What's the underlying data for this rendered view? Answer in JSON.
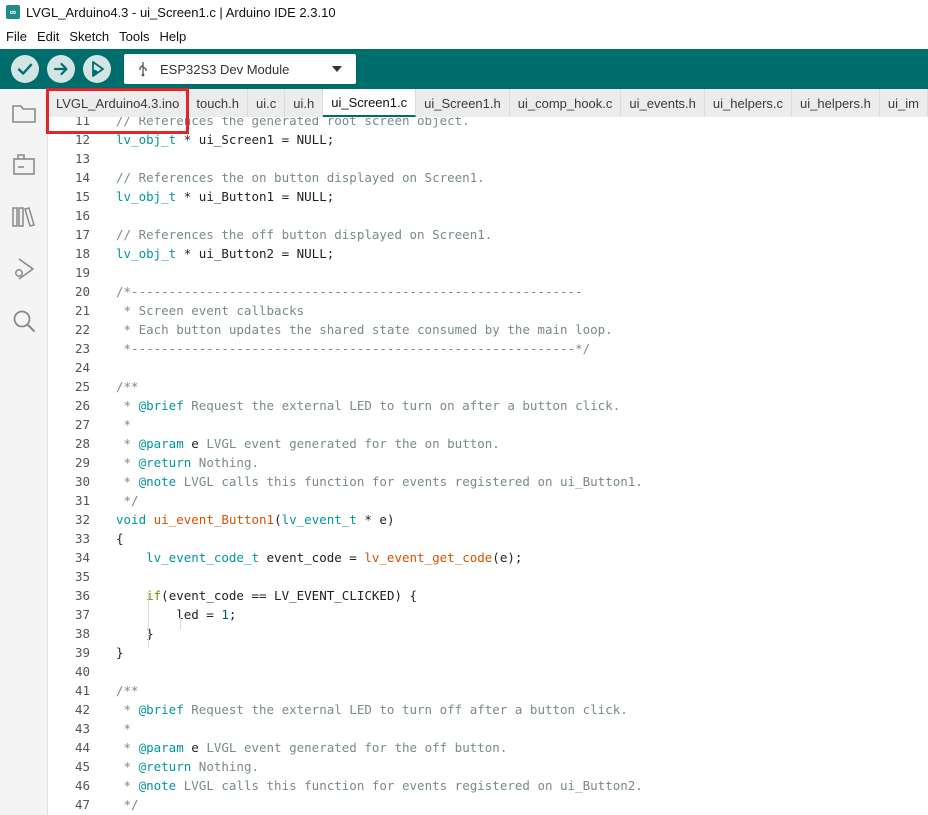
{
  "window": {
    "title": "LVGL_Arduino4.3 - ui_Screen1.c | Arduino IDE 2.3.10",
    "app_icon_glyph": "∞"
  },
  "menu": [
    "File",
    "Edit",
    "Sketch",
    "Tools",
    "Help"
  ],
  "toolbar": {
    "verify_icon": "check-icon",
    "upload_icon": "arrow-right-icon",
    "debug_icon": "debug-icon",
    "board": "ESP32S3 Dev Module"
  },
  "sidebar": [
    "folder-icon",
    "board-manager-icon",
    "library-icon",
    "debug-icon",
    "search-icon"
  ],
  "tabs": [
    {
      "label": "LVGL_Arduino4.3.ino",
      "active": false
    },
    {
      "label": "touch.h",
      "active": false
    },
    {
      "label": "ui.c",
      "active": false
    },
    {
      "label": "ui.h",
      "active": false
    },
    {
      "label": "ui_Screen1.c",
      "active": true
    },
    {
      "label": "ui_Screen1.h",
      "active": false
    },
    {
      "label": "ui_comp_hook.c",
      "active": false
    },
    {
      "label": "ui_events.h",
      "active": false
    },
    {
      "label": "ui_helpers.c",
      "active": false
    },
    {
      "label": "ui_helpers.h",
      "active": false
    },
    {
      "label": "ui_im",
      "active": false
    }
  ],
  "colors": {
    "accent": "#006d6d",
    "highlight": "#e0262b",
    "comment": "#7a8a8b",
    "type": "#00979d",
    "function": "#d35400",
    "keyword": "#728e00"
  },
  "code": [
    {
      "n": "11",
      "tokens": [
        [
          "c",
          "// References the generated root screen object."
        ]
      ]
    },
    {
      "n": "12",
      "tokens": [
        [
          "t",
          "lv_obj_t"
        ],
        [
          "p",
          " * ui_Screen1 = NULL;"
        ]
      ]
    },
    {
      "n": "13",
      "tokens": []
    },
    {
      "n": "14",
      "tokens": [
        [
          "c",
          "// References the on button displayed on Screen1."
        ]
      ]
    },
    {
      "n": "15",
      "tokens": [
        [
          "t",
          "lv_obj_t"
        ],
        [
          "p",
          " * ui_Button1 = NULL;"
        ]
      ]
    },
    {
      "n": "16",
      "tokens": []
    },
    {
      "n": "17",
      "tokens": [
        [
          "c",
          "// References the off button displayed on Screen1."
        ]
      ]
    },
    {
      "n": "18",
      "tokens": [
        [
          "t",
          "lv_obj_t"
        ],
        [
          "p",
          " * ui_Button2 = NULL;"
        ]
      ]
    },
    {
      "n": "19",
      "tokens": []
    },
    {
      "n": "20",
      "tokens": [
        [
          "c",
          "/*------------------------------------------------------------"
        ]
      ]
    },
    {
      "n": "21",
      "tokens": [
        [
          "c",
          " * Screen event callbacks"
        ]
      ]
    },
    {
      "n": "22",
      "tokens": [
        [
          "c",
          " * Each button updates the shared state consumed by the main loop."
        ]
      ]
    },
    {
      "n": "23",
      "tokens": [
        [
          "c",
          " *-----------------------------------------------------------*/"
        ]
      ]
    },
    {
      "n": "24",
      "tokens": []
    },
    {
      "n": "25",
      "tokens": [
        [
          "c",
          "/**"
        ]
      ]
    },
    {
      "n": "26",
      "tokens": [
        [
          "c",
          " * "
        ],
        [
          "t",
          "@brief"
        ],
        [
          "c",
          " Request the external LED to turn on after a button click."
        ]
      ]
    },
    {
      "n": "27",
      "tokens": [
        [
          "c",
          " *"
        ]
      ]
    },
    {
      "n": "28",
      "tokens": [
        [
          "c",
          " * "
        ],
        [
          "t",
          "@param"
        ],
        [
          "c",
          " "
        ],
        [
          "p",
          "e"
        ],
        [
          "c",
          " LVGL event generated for the on button."
        ]
      ]
    },
    {
      "n": "29",
      "tokens": [
        [
          "c",
          " * "
        ],
        [
          "t",
          "@return"
        ],
        [
          "c",
          " Nothing."
        ]
      ]
    },
    {
      "n": "30",
      "tokens": [
        [
          "c",
          " * "
        ],
        [
          "t",
          "@note"
        ],
        [
          "c",
          " LVGL calls this function for events registered on ui_Button1."
        ]
      ]
    },
    {
      "n": "31",
      "tokens": [
        [
          "c",
          " */"
        ]
      ]
    },
    {
      "n": "32",
      "tokens": [
        [
          "t",
          "void"
        ],
        [
          "p",
          " "
        ],
        [
          "f",
          "ui_event_Button1"
        ],
        [
          "p",
          "("
        ],
        [
          "t",
          "lv_event_t"
        ],
        [
          "p",
          " * e)"
        ]
      ]
    },
    {
      "n": "33",
      "tokens": [
        [
          "p",
          "{"
        ]
      ]
    },
    {
      "n": "34",
      "tokens": [
        [
          "p",
          "    "
        ],
        [
          "t",
          "lv_event_code_t"
        ],
        [
          "p",
          " event_code = "
        ],
        [
          "f",
          "lv_event_get_code"
        ],
        [
          "p",
          "(e);"
        ]
      ]
    },
    {
      "n": "35",
      "tokens": []
    },
    {
      "n": "36",
      "tokens": [
        [
          "p",
          "    "
        ],
        [
          "k",
          "if"
        ],
        [
          "p",
          "(event_code == LV_EVENT_CLICKED) {"
        ]
      ]
    },
    {
      "n": "37",
      "tokens": [
        [
          "p",
          "        led = "
        ],
        [
          "n",
          "1"
        ],
        [
          "p",
          ";"
        ]
      ]
    },
    {
      "n": "38",
      "tokens": [
        [
          "p",
          "    }"
        ]
      ]
    },
    {
      "n": "39",
      "tokens": [
        [
          "p",
          "}"
        ]
      ]
    },
    {
      "n": "40",
      "tokens": []
    },
    {
      "n": "41",
      "tokens": [
        [
          "c",
          "/**"
        ]
      ]
    },
    {
      "n": "42",
      "tokens": [
        [
          "c",
          " * "
        ],
        [
          "t",
          "@brief"
        ],
        [
          "c",
          " Request the external LED to turn off after a button click."
        ]
      ]
    },
    {
      "n": "43",
      "tokens": [
        [
          "c",
          " *"
        ]
      ]
    },
    {
      "n": "44",
      "tokens": [
        [
          "c",
          " * "
        ],
        [
          "t",
          "@param"
        ],
        [
          "c",
          " "
        ],
        [
          "p",
          "e"
        ],
        [
          "c",
          " LVGL event generated for the off button."
        ]
      ]
    },
    {
      "n": "45",
      "tokens": [
        [
          "c",
          " * "
        ],
        [
          "t",
          "@return"
        ],
        [
          "c",
          " Nothing."
        ]
      ]
    },
    {
      "n": "46",
      "tokens": [
        [
          "c",
          " * "
        ],
        [
          "t",
          "@note"
        ],
        [
          "c",
          " LVGL calls this function for events registered on ui_Button2."
        ]
      ]
    },
    {
      "n": "47",
      "tokens": [
        [
          "c",
          " */"
        ]
      ]
    }
  ]
}
